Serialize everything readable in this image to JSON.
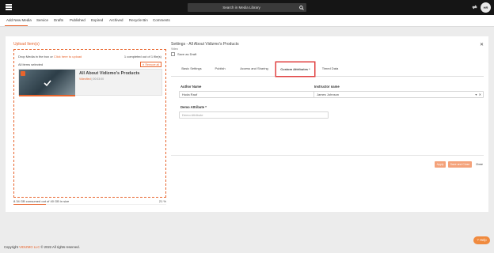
{
  "topbar": {
    "search_placeholder": "Search in Media Library",
    "user_initials": "HR"
  },
  "nav": {
    "items": [
      "Add New Media",
      "Service",
      "Drafts",
      "Published",
      "Expired",
      "Archived",
      "Recycle Bin",
      "Comments"
    ],
    "active_index": 0
  },
  "upload": {
    "title": "Upload Item(s)",
    "drop_prefix": "Drop Media in the box or ",
    "drop_link": "Click here to upload",
    "completed": "1 completed out of 1 file(s)",
    "all_selected": "All items selected",
    "remove_all": "Remove all",
    "media": {
      "title": "All About Vidizmo's Products",
      "meta_prefix": "Videofied",
      "meta_suffix": "| 00:03:00"
    },
    "consumed_text": "8.34 GB consumed out of 40 GB in size",
    "consumed_pct": "21 %",
    "consumed_fraction": 0.21
  },
  "settings": {
    "title": "Settings - All About Vidizmo's Products",
    "subtitle": "Video",
    "save_as_draft": "Save as Draft",
    "tabs": [
      "Basic Settings",
      "Publish",
      "Access and Sharing",
      "Custom Attributes *",
      "Timed Data"
    ],
    "active_tab_index": 3,
    "fields": {
      "author_label": "Author Name",
      "author_value": "Huda Rauf",
      "instructor_label": "Instructor name",
      "instructor_value": "James Johnson",
      "demo_label": "Demo Attribute *",
      "demo_placeholder": "Demo Attribute"
    },
    "buttons": {
      "apply": "Apply",
      "save_close": "Save and Close",
      "close": "Close"
    }
  },
  "footer": {
    "copyright_prefix": "Copyright ",
    "brand": "VIDIZMO LLC",
    "copyright_suffix": " © 2022 All rights reserved."
  },
  "help": {
    "label": "Help"
  },
  "colors": {
    "accent": "#e8642c",
    "topbar": "#151515",
    "active_tab_border": "#e04040"
  }
}
